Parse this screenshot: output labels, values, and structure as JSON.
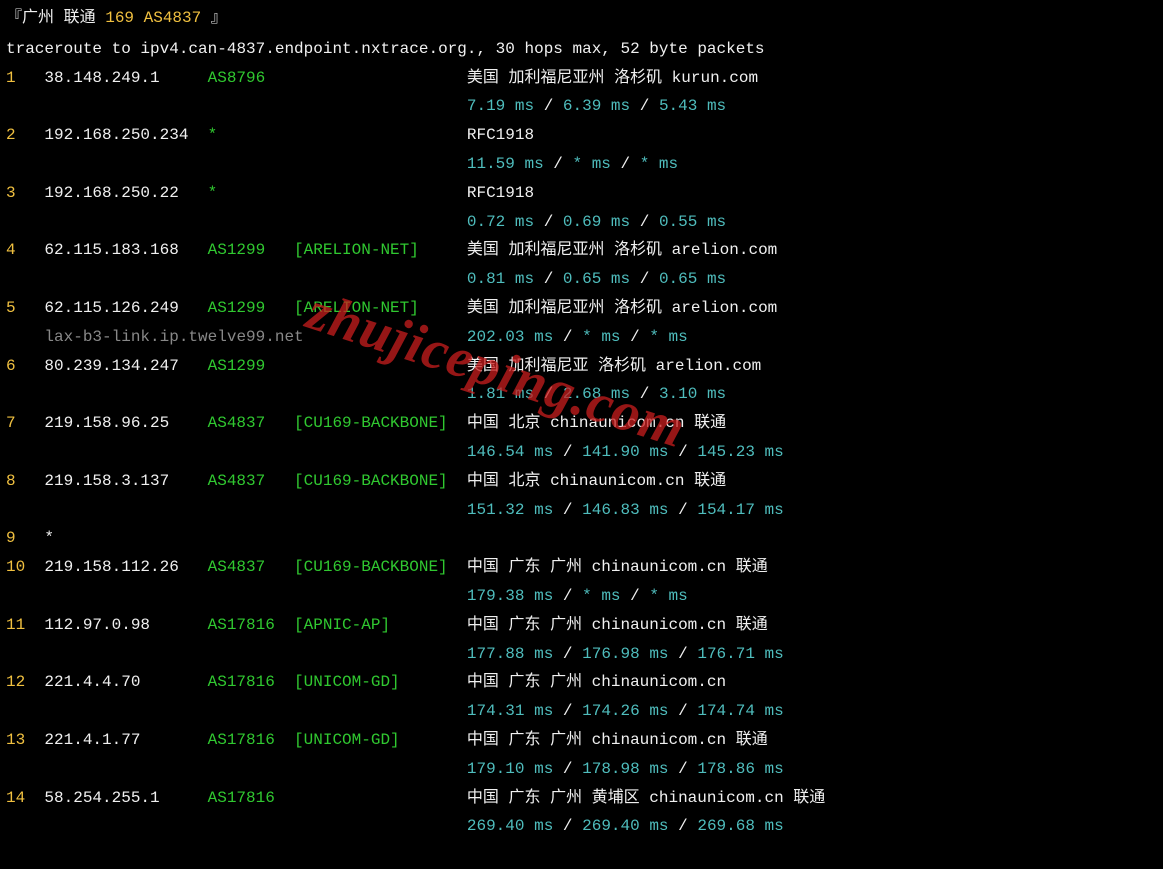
{
  "header_pre": "『广州 联通 ",
  "header_mid": "169 AS4837",
  "header_post": " 』",
  "traceroute_line": "traceroute to ipv4.can-4837.endpoint.nxtrace.org., 30 hops max, 52 byte packets",
  "watermark": "zhujiceping.com",
  "hops": [
    {
      "num": "1",
      "ip": "38.148.249.1",
      "asn": "AS8796",
      "tag": "",
      "loc": "美国 加利福尼亚州 洛杉矶  kurun.com",
      "rdns": "",
      "t1": "7.19 ms",
      "t2": "6.39 ms",
      "t3": "5.43 ms"
    },
    {
      "num": "2",
      "ip": "192.168.250.234",
      "asn": "*",
      "tag": "",
      "loc": "RFC1918",
      "rdns": "",
      "t1": "11.59 ms",
      "t2": "* ms",
      "t3": "* ms"
    },
    {
      "num": "3",
      "ip": "192.168.250.22",
      "asn": "*",
      "tag": "",
      "loc": "RFC1918",
      "rdns": "",
      "t1": "0.72 ms",
      "t2": "0.69 ms",
      "t3": "0.55 ms"
    },
    {
      "num": "4",
      "ip": "62.115.183.168",
      "asn": "AS1299",
      "tag": "[ARELION-NET]",
      "loc": "美国 加利福尼亚州 洛杉矶  arelion.com",
      "rdns": "",
      "t1": "0.81 ms",
      "t2": "0.65 ms",
      "t3": "0.65 ms"
    },
    {
      "num": "5",
      "ip": "62.115.126.249",
      "asn": "AS1299",
      "tag": "[ARELION-NET]",
      "loc": "美国 加利福尼亚州 洛杉矶  arelion.com",
      "rdns": "lax-b3-link.ip.twelve99.net",
      "t1": "202.03 ms",
      "t2": "* ms",
      "t3": "* ms"
    },
    {
      "num": "6",
      "ip": "80.239.134.247",
      "asn": "AS1299",
      "tag": "",
      "loc": "美国 加利福尼亚 洛杉矶  arelion.com",
      "rdns": "",
      "t1": "1.81 ms",
      "t2": "2.68 ms",
      "t3": "3.10 ms"
    },
    {
      "num": "7",
      "ip": "219.158.96.25",
      "asn": "AS4837",
      "tag": "[CU169-BACKBONE]",
      "loc": "中国 北京   chinaunicom.cn  联通",
      "rdns": "",
      "t1": "146.54 ms",
      "t2": "141.90 ms",
      "t3": "145.23 ms"
    },
    {
      "num": "8",
      "ip": "219.158.3.137",
      "asn": "AS4837",
      "tag": "[CU169-BACKBONE]",
      "loc": "中国 北京   chinaunicom.cn  联通",
      "rdns": "",
      "t1": "151.32 ms",
      "t2": "146.83 ms",
      "t3": "154.17 ms"
    },
    {
      "num": "9",
      "ip": "*",
      "asn": "",
      "tag": "",
      "loc": "",
      "rdns": "",
      "t1": "",
      "t2": "",
      "t3": ""
    },
    {
      "num": "10",
      "ip": "219.158.112.26",
      "asn": "AS4837",
      "tag": "[CU169-BACKBONE]",
      "loc": "中国 广东 广州  chinaunicom.cn  联通",
      "rdns": "",
      "t1": "179.38 ms",
      "t2": "* ms",
      "t3": "* ms"
    },
    {
      "num": "11",
      "ip": "112.97.0.98",
      "asn": "AS17816",
      "tag": "[APNIC-AP]",
      "loc": "中国 广东 广州  chinaunicom.cn  联通",
      "rdns": "",
      "t1": "177.88 ms",
      "t2": "176.98 ms",
      "t3": "176.71 ms"
    },
    {
      "num": "12",
      "ip": "221.4.4.70",
      "asn": "AS17816",
      "tag": "[UNICOM-GD]",
      "loc": "中国 广东 广州  chinaunicom.cn",
      "rdns": "",
      "t1": "174.31 ms",
      "t2": "174.26 ms",
      "t3": "174.74 ms"
    },
    {
      "num": "13",
      "ip": "221.4.1.77",
      "asn": "AS17816",
      "tag": "[UNICOM-GD]",
      "loc": "中国 广东 广州  chinaunicom.cn  联通",
      "rdns": "",
      "t1": "179.10 ms",
      "t2": "178.98 ms",
      "t3": "178.86 ms"
    },
    {
      "num": "14",
      "ip": "58.254.255.1",
      "asn": "AS17816",
      "tag": "",
      "loc": "中国 广东 广州 黄埔区 chinaunicom.cn  联通",
      "rdns": "",
      "t1": "269.40 ms",
      "t2": "269.40 ms",
      "t3": "269.68 ms"
    }
  ]
}
